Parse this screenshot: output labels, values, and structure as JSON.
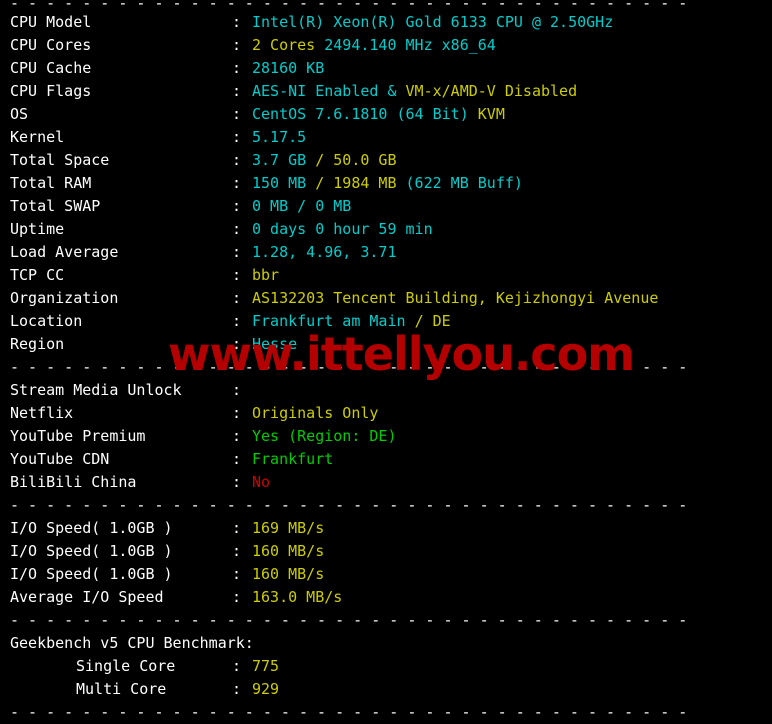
{
  "watermark": "www.ittellyou.com",
  "colors": {
    "background": "#000000",
    "label": "#ffffff",
    "cyan": "#00cdcd",
    "yellow": "#cdcd00",
    "green": "#00cd00",
    "red": "#cd0000",
    "watermark": "#b40000"
  },
  "separator_char": "-",
  "separator": "--------------------------------------------------------------",
  "colon": ":",
  "sections": {
    "system": {
      "rows": [
        {
          "label": "CPU Model",
          "parts": [
            {
              "text": "Intel(R) Xeon(R) Gold 6133 CPU @ 2.50GHz",
              "color": "cyan"
            }
          ]
        },
        {
          "label": "CPU Cores",
          "parts": [
            {
              "text": "2 Cores",
              "color": "yellow"
            },
            {
              "text": " 2494.140 MHz x86_64",
              "color": "cyan"
            }
          ]
        },
        {
          "label": "CPU Cache",
          "parts": [
            {
              "text": "28160 KB",
              "color": "cyan"
            }
          ]
        },
        {
          "label": "CPU Flags",
          "parts": [
            {
              "text": "AES-NI Enabled",
              "color": "cyan"
            },
            {
              "text": " & ",
              "color": "cyan"
            },
            {
              "text": "VM-x/AMD-V Disabled",
              "color": "yellow"
            }
          ]
        },
        {
          "label": "OS",
          "parts": [
            {
              "text": "CentOS 7.6.1810 (64 Bit) ",
              "color": "cyan"
            },
            {
              "text": "KVM",
              "color": "yellow"
            }
          ]
        },
        {
          "label": "Kernel",
          "parts": [
            {
              "text": "5.17.5",
              "color": "cyan"
            }
          ]
        },
        {
          "label": "Total Space",
          "parts": [
            {
              "text": "3.7 GB ",
              "color": "cyan"
            },
            {
              "text": "/ 50.0 GB",
              "color": "yellow"
            }
          ]
        },
        {
          "label": "Total RAM",
          "parts": [
            {
              "text": "150 MB ",
              "color": "cyan"
            },
            {
              "text": "/ 1984 MB ",
              "color": "yellow"
            },
            {
              "text": "(622 MB Buff)",
              "color": "cyan"
            }
          ]
        },
        {
          "label": "Total SWAP",
          "parts": [
            {
              "text": "0 MB / 0 MB",
              "color": "cyan"
            }
          ]
        },
        {
          "label": "Uptime",
          "parts": [
            {
              "text": "0 days 0 hour 59 min",
              "color": "cyan"
            }
          ]
        },
        {
          "label": "Load Average",
          "parts": [
            {
              "text": "1.28, 4.96, 3.71",
              "color": "cyan"
            }
          ]
        },
        {
          "label": "TCP CC",
          "parts": [
            {
              "text": "bbr",
              "color": "yellow"
            }
          ]
        },
        {
          "label": "Organization",
          "parts": [
            {
              "text": "AS132203 Tencent Building, Kejizhongyi Avenue",
              "color": "yellow"
            }
          ]
        },
        {
          "label": "Location",
          "parts": [
            {
              "text": "Frankfurt am Main ",
              "color": "cyan"
            },
            {
              "text": "/ DE",
              "color": "yellow"
            }
          ]
        },
        {
          "label": "Region",
          "parts": [
            {
              "text": "Hesse",
              "color": "cyan"
            }
          ]
        }
      ]
    },
    "stream_media": {
      "rows": [
        {
          "label": "Stream Media Unlock",
          "parts": []
        },
        {
          "label": "Netflix",
          "parts": [
            {
              "text": "Originals Only",
              "color": "yellow"
            }
          ]
        },
        {
          "label": "YouTube Premium",
          "parts": [
            {
              "text": "Yes (Region: DE)",
              "color": "green"
            }
          ]
        },
        {
          "label": "YouTube CDN",
          "parts": [
            {
              "text": "Frankfurt",
              "color": "green"
            }
          ]
        },
        {
          "label": "BiliBili China",
          "parts": [
            {
              "text": "No",
              "color": "red"
            }
          ]
        }
      ]
    },
    "io_speed": {
      "rows": [
        {
          "label": "I/O Speed( 1.0GB )",
          "parts": [
            {
              "text": "169 MB/s",
              "color": "yellow"
            }
          ]
        },
        {
          "label": "I/O Speed( 1.0GB )",
          "parts": [
            {
              "text": "160 MB/s",
              "color": "yellow"
            }
          ]
        },
        {
          "label": "I/O Speed( 1.0GB )",
          "parts": [
            {
              "text": "160 MB/s",
              "color": "yellow"
            }
          ]
        },
        {
          "label": "Average I/O Speed",
          "parts": [
            {
              "text": "163.0 MB/s",
              "color": "yellow"
            }
          ]
        }
      ]
    },
    "geekbench": {
      "title": "Geekbench v5 CPU Benchmark:",
      "rows": [
        {
          "label": "Single Core",
          "indent": true,
          "parts": [
            {
              "text": "775",
              "color": "yellow"
            }
          ]
        },
        {
          "label": "Multi Core",
          "indent": true,
          "parts": [
            {
              "text": "929",
              "color": "yellow"
            }
          ]
        }
      ]
    }
  }
}
